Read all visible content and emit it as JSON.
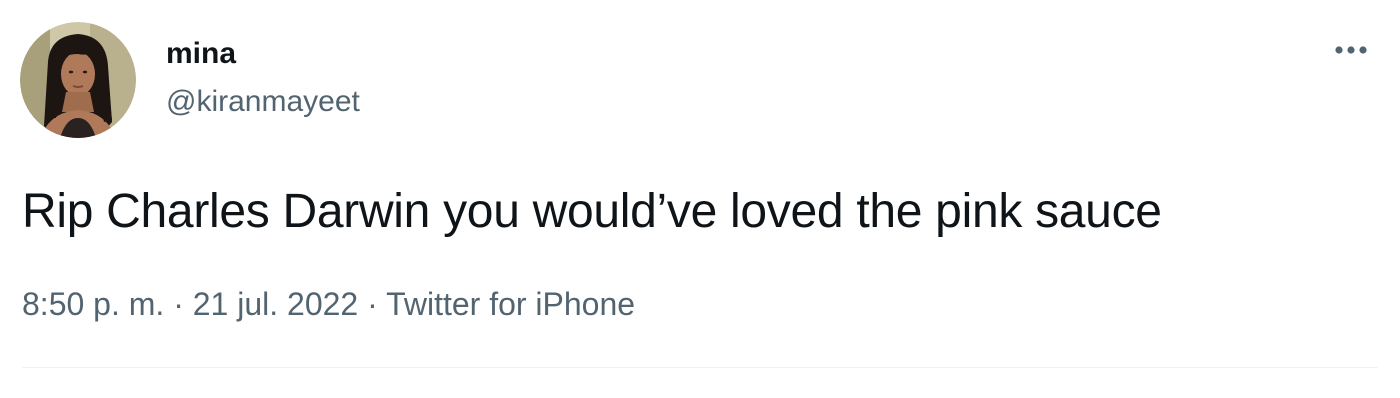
{
  "user": {
    "display_name": "mina",
    "handle": "@kiranmayeet",
    "avatar_icon": "profile-photo"
  },
  "tweet": {
    "text": "Rip Charles Darwin you would’ve loved the pink sauce",
    "time": "8:50 p. m.",
    "separator": " · ",
    "date": "21 jul. 2022",
    "source": "Twitter for iPhone"
  },
  "menu": {
    "icon": "more-horizontal-icon"
  },
  "colors": {
    "text_primary": "#0f1419",
    "text_secondary": "#536471",
    "divider": "#eff3f4"
  }
}
